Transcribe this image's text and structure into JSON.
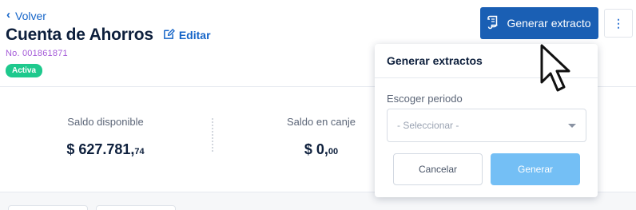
{
  "header": {
    "back_label": "Volver",
    "title": "Cuenta de Ahorros",
    "edit_label": "Editar",
    "account_number": "No. 001861871",
    "status": "Activa"
  },
  "actions": {
    "generate_statement_label": "Generar extracto",
    "more_icon": "⋮"
  },
  "balances": {
    "available": {
      "label": "Saldo disponible",
      "integer": "$ 627.781,",
      "cents": "74"
    },
    "exchange": {
      "label": "Saldo en canje",
      "integer": "$ 0,",
      "cents": "00"
    }
  },
  "popover": {
    "title": "Generar extractos",
    "period_label": "Escoger periodo",
    "period_placeholder": "- Seleccionar -",
    "cancel_label": "Cancelar",
    "submit_label": "Generar"
  },
  "colors": {
    "brand": "#1a5fb4",
    "link": "#1464c8",
    "status_active": "#1ec98d",
    "account_number": "#a45ad8",
    "disabled_primary": "#74bff5"
  }
}
